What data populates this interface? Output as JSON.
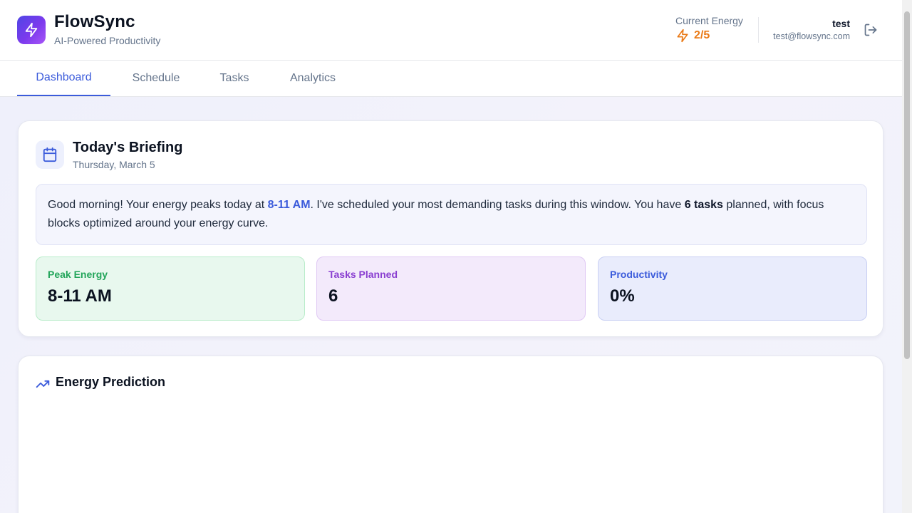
{
  "app": {
    "title": "FlowSync",
    "subtitle": "AI-Powered Productivity"
  },
  "energy": {
    "label": "Current Energy",
    "value": "2/5",
    "color": "#ea7a17"
  },
  "user": {
    "name": "test",
    "email": "test@flowsync.com"
  },
  "tabs": [
    {
      "label": "Dashboard",
      "active": true
    },
    {
      "label": "Schedule",
      "active": false
    },
    {
      "label": "Tasks",
      "active": false
    },
    {
      "label": "Analytics",
      "active": false
    }
  ],
  "briefing": {
    "title": "Today's Briefing",
    "date": "Thursday, March 5",
    "message": {
      "part1": "Good morning! Your energy peaks today at ",
      "peak": "8-11 AM",
      "part2": ". I've scheduled your most demanding tasks during this window. You have ",
      "tasks": "6 tasks",
      "part3": " planned, with focus blocks optimized around your energy curve."
    },
    "stats": [
      {
        "label": "Peak Energy",
        "value": "8-11 AM"
      },
      {
        "label": "Tasks Planned",
        "value": "6"
      },
      {
        "label": "Productivity",
        "value": "0%"
      }
    ]
  },
  "energy_prediction": {
    "title": "Energy Prediction"
  },
  "colors": {
    "accent": "#3b5bdb",
    "green": "#22a55a",
    "purple": "#8a3fd1"
  }
}
